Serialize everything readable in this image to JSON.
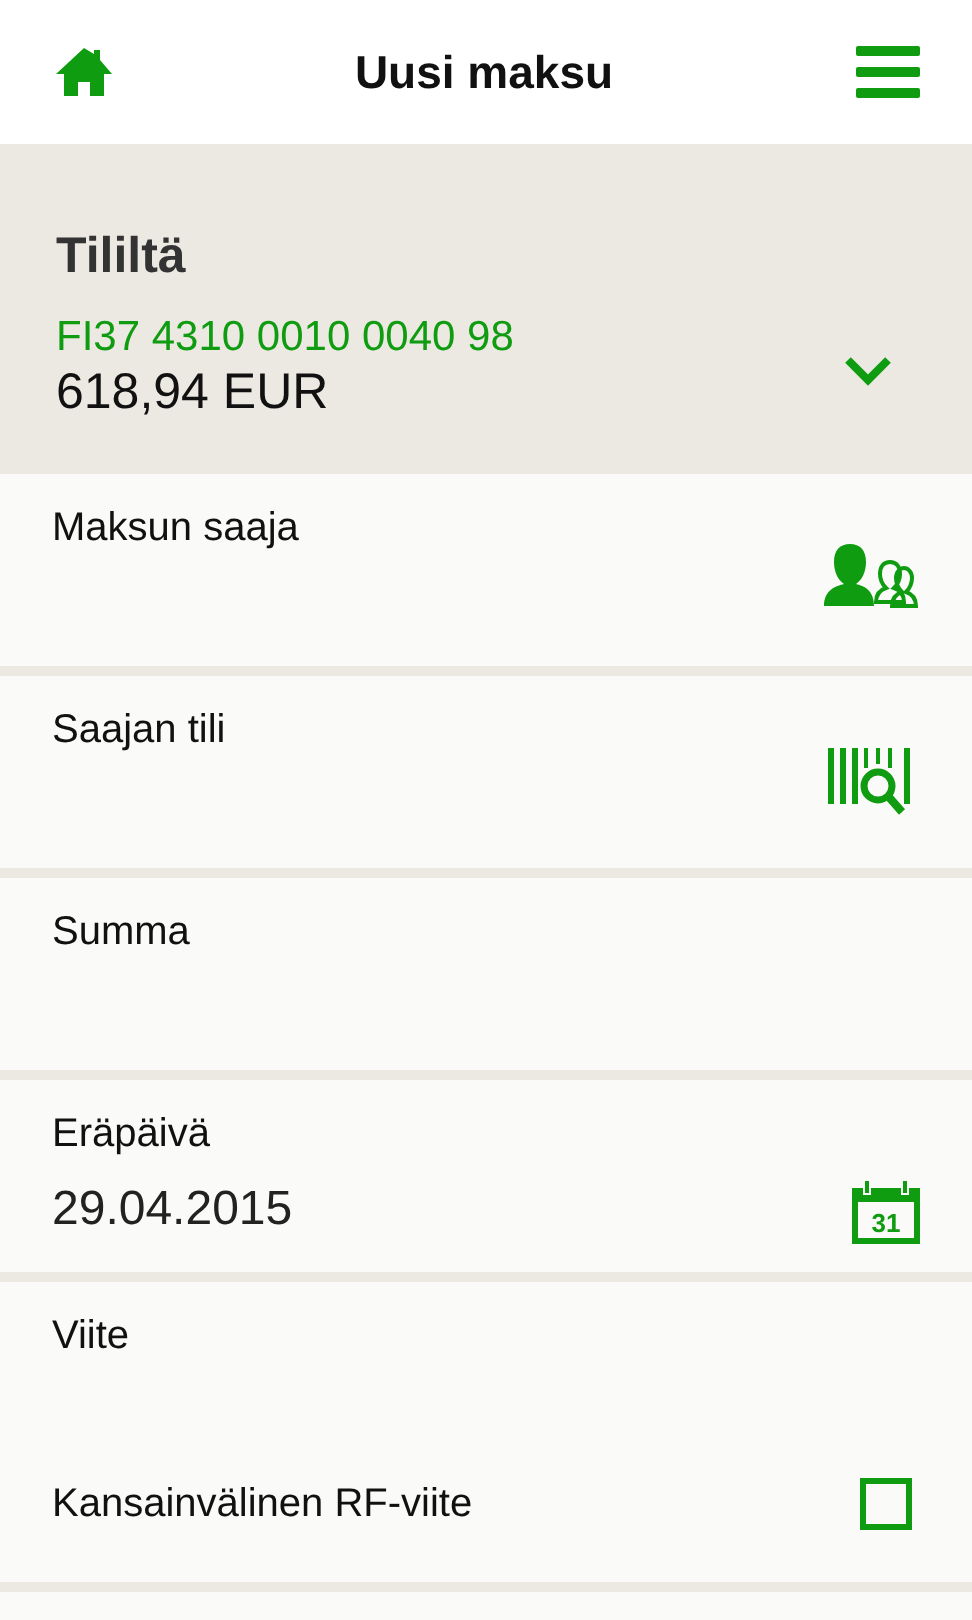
{
  "header": {
    "title": "Uusi maksu"
  },
  "account": {
    "label": "Tililtä",
    "iban": "FI37 4310 0010 0040 98",
    "balance": "618,94 EUR"
  },
  "fields": [
    {
      "label": "Maksun saaja",
      "kind": "contacts"
    },
    {
      "label": "Saajan tili",
      "kind": "scan"
    },
    {
      "label": "Summa",
      "kind": "plain"
    },
    {
      "label": "Eräpäivä",
      "value": "29.04.2015",
      "kind": "calendar",
      "day": "31"
    },
    {
      "label": "Viite",
      "kind": "plain",
      "option": {
        "label": "Kansainvälinen RF-viite",
        "checked": false
      }
    }
  ]
}
